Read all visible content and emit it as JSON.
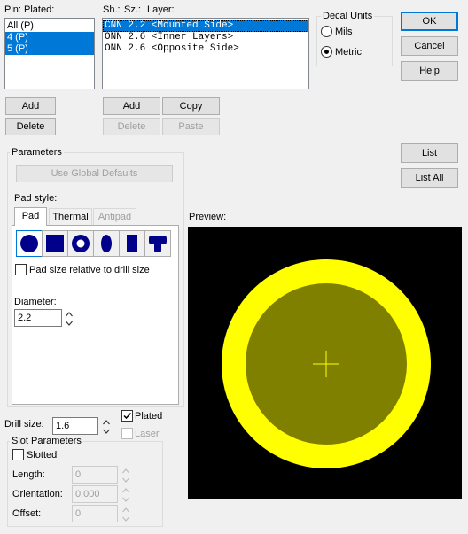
{
  "pins": {
    "header_pin": "Pin:",
    "header_plated": "Plated:",
    "items": [
      {
        "label": "All (P)",
        "selected": false
      },
      {
        "label": "4 (P)",
        "selected": true
      },
      {
        "label": "5 (P)",
        "selected": true
      }
    ],
    "add": "Add",
    "delete": "Delete"
  },
  "stack": {
    "header_sh": "Sh.:",
    "header_sz": "Sz.:",
    "header_layer": "Layer:",
    "items": [
      {
        "label": "CNN 2.2 <Mounted Side>",
        "selected": true
      },
      {
        "label": "ONN 2.6 <Inner Layers>",
        "selected": false
      },
      {
        "label": "ONN 2.6 <Opposite Side>",
        "selected": false
      }
    ],
    "add": "Add",
    "copy": "Copy",
    "delete": "Delete",
    "paste": "Paste"
  },
  "decal_units": {
    "title": "Decal Units",
    "mils": "Mils",
    "metric": "Metric",
    "selected": "metric"
  },
  "dialog": {
    "ok": "OK",
    "cancel": "Cancel",
    "help": "Help",
    "list": "List",
    "list_all": "List All"
  },
  "parameters": {
    "title": "Parameters",
    "use_global": "Use Global Defaults",
    "pad_style": "Pad style:",
    "tabs": [
      "Pad",
      "Thermal",
      "Antipad"
    ],
    "shapes": [
      "round-pad-icon",
      "square-pad-icon",
      "annular-pad-icon",
      "oval-pad-icon",
      "rectangle-pad-icon",
      "custom-pad-icon"
    ],
    "relative_label": "Pad size relative to drill size",
    "relative_checked": false,
    "diameter_label": "Diameter:",
    "diameter_value": "2.2"
  },
  "drill": {
    "label": "Drill size:",
    "value": "1.6",
    "plated_label": "Plated",
    "plated_checked": true,
    "laser_label": "Laser",
    "laser_checked": false
  },
  "slot": {
    "title": "Slot Parameters",
    "slotted_label": "Slotted",
    "slotted_checked": false,
    "length_label": "Length:",
    "length_value": "0",
    "orientation_label": "Orientation:",
    "orientation_value": "0.000",
    "offset_label": "Offset:",
    "offset_value": "0"
  },
  "preview": {
    "label": "Preview:",
    "outer_color": "#ffff00",
    "inner_color": "#808000",
    "background": "#000000",
    "outer_diameter": 2.6,
    "inner_diameter": 2.2,
    "drill_diameter": 1.6
  },
  "colors": {
    "accent": "#0078d7",
    "pad_icon": "#00008b"
  }
}
